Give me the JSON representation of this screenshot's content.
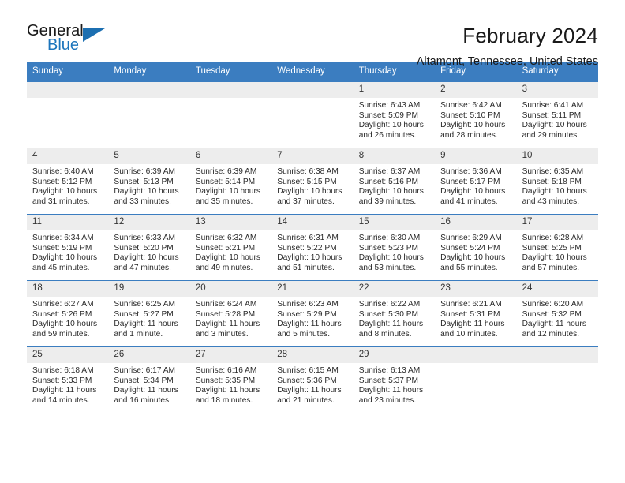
{
  "brand": {
    "name_part1": "General",
    "name_part2": "Blue",
    "accent_color": "#1c75bc"
  },
  "header": {
    "title": "February 2024",
    "subtitle": "Altamont, Tennessee, United States",
    "header_bg_color": "#3b7dc0"
  },
  "weekdays": [
    "Sunday",
    "Monday",
    "Tuesday",
    "Wednesday",
    "Thursday",
    "Friday",
    "Saturday"
  ],
  "weeks": [
    [
      {
        "day": "",
        "sunrise": "",
        "sunset": "",
        "daylight1": "",
        "daylight2": ""
      },
      {
        "day": "",
        "sunrise": "",
        "sunset": "",
        "daylight1": "",
        "daylight2": ""
      },
      {
        "day": "",
        "sunrise": "",
        "sunset": "",
        "daylight1": "",
        "daylight2": ""
      },
      {
        "day": "",
        "sunrise": "",
        "sunset": "",
        "daylight1": "",
        "daylight2": ""
      },
      {
        "day": "1",
        "sunrise": "Sunrise: 6:43 AM",
        "sunset": "Sunset: 5:09 PM",
        "daylight1": "Daylight: 10 hours",
        "daylight2": "and 26 minutes."
      },
      {
        "day": "2",
        "sunrise": "Sunrise: 6:42 AM",
        "sunset": "Sunset: 5:10 PM",
        "daylight1": "Daylight: 10 hours",
        "daylight2": "and 28 minutes."
      },
      {
        "day": "3",
        "sunrise": "Sunrise: 6:41 AM",
        "sunset": "Sunset: 5:11 PM",
        "daylight1": "Daylight: 10 hours",
        "daylight2": "and 29 minutes."
      }
    ],
    [
      {
        "day": "4",
        "sunrise": "Sunrise: 6:40 AM",
        "sunset": "Sunset: 5:12 PM",
        "daylight1": "Daylight: 10 hours",
        "daylight2": "and 31 minutes."
      },
      {
        "day": "5",
        "sunrise": "Sunrise: 6:39 AM",
        "sunset": "Sunset: 5:13 PM",
        "daylight1": "Daylight: 10 hours",
        "daylight2": "and 33 minutes."
      },
      {
        "day": "6",
        "sunrise": "Sunrise: 6:39 AM",
        "sunset": "Sunset: 5:14 PM",
        "daylight1": "Daylight: 10 hours",
        "daylight2": "and 35 minutes."
      },
      {
        "day": "7",
        "sunrise": "Sunrise: 6:38 AM",
        "sunset": "Sunset: 5:15 PM",
        "daylight1": "Daylight: 10 hours",
        "daylight2": "and 37 minutes."
      },
      {
        "day": "8",
        "sunrise": "Sunrise: 6:37 AM",
        "sunset": "Sunset: 5:16 PM",
        "daylight1": "Daylight: 10 hours",
        "daylight2": "and 39 minutes."
      },
      {
        "day": "9",
        "sunrise": "Sunrise: 6:36 AM",
        "sunset": "Sunset: 5:17 PM",
        "daylight1": "Daylight: 10 hours",
        "daylight2": "and 41 minutes."
      },
      {
        "day": "10",
        "sunrise": "Sunrise: 6:35 AM",
        "sunset": "Sunset: 5:18 PM",
        "daylight1": "Daylight: 10 hours",
        "daylight2": "and 43 minutes."
      }
    ],
    [
      {
        "day": "11",
        "sunrise": "Sunrise: 6:34 AM",
        "sunset": "Sunset: 5:19 PM",
        "daylight1": "Daylight: 10 hours",
        "daylight2": "and 45 minutes."
      },
      {
        "day": "12",
        "sunrise": "Sunrise: 6:33 AM",
        "sunset": "Sunset: 5:20 PM",
        "daylight1": "Daylight: 10 hours",
        "daylight2": "and 47 minutes."
      },
      {
        "day": "13",
        "sunrise": "Sunrise: 6:32 AM",
        "sunset": "Sunset: 5:21 PM",
        "daylight1": "Daylight: 10 hours",
        "daylight2": "and 49 minutes."
      },
      {
        "day": "14",
        "sunrise": "Sunrise: 6:31 AM",
        "sunset": "Sunset: 5:22 PM",
        "daylight1": "Daylight: 10 hours",
        "daylight2": "and 51 minutes."
      },
      {
        "day": "15",
        "sunrise": "Sunrise: 6:30 AM",
        "sunset": "Sunset: 5:23 PM",
        "daylight1": "Daylight: 10 hours",
        "daylight2": "and 53 minutes."
      },
      {
        "day": "16",
        "sunrise": "Sunrise: 6:29 AM",
        "sunset": "Sunset: 5:24 PM",
        "daylight1": "Daylight: 10 hours",
        "daylight2": "and 55 minutes."
      },
      {
        "day": "17",
        "sunrise": "Sunrise: 6:28 AM",
        "sunset": "Sunset: 5:25 PM",
        "daylight1": "Daylight: 10 hours",
        "daylight2": "and 57 minutes."
      }
    ],
    [
      {
        "day": "18",
        "sunrise": "Sunrise: 6:27 AM",
        "sunset": "Sunset: 5:26 PM",
        "daylight1": "Daylight: 10 hours",
        "daylight2": "and 59 minutes."
      },
      {
        "day": "19",
        "sunrise": "Sunrise: 6:25 AM",
        "sunset": "Sunset: 5:27 PM",
        "daylight1": "Daylight: 11 hours",
        "daylight2": "and 1 minute."
      },
      {
        "day": "20",
        "sunrise": "Sunrise: 6:24 AM",
        "sunset": "Sunset: 5:28 PM",
        "daylight1": "Daylight: 11 hours",
        "daylight2": "and 3 minutes."
      },
      {
        "day": "21",
        "sunrise": "Sunrise: 6:23 AM",
        "sunset": "Sunset: 5:29 PM",
        "daylight1": "Daylight: 11 hours",
        "daylight2": "and 5 minutes."
      },
      {
        "day": "22",
        "sunrise": "Sunrise: 6:22 AM",
        "sunset": "Sunset: 5:30 PM",
        "daylight1": "Daylight: 11 hours",
        "daylight2": "and 8 minutes."
      },
      {
        "day": "23",
        "sunrise": "Sunrise: 6:21 AM",
        "sunset": "Sunset: 5:31 PM",
        "daylight1": "Daylight: 11 hours",
        "daylight2": "and 10 minutes."
      },
      {
        "day": "24",
        "sunrise": "Sunrise: 6:20 AM",
        "sunset": "Sunset: 5:32 PM",
        "daylight1": "Daylight: 11 hours",
        "daylight2": "and 12 minutes."
      }
    ],
    [
      {
        "day": "25",
        "sunrise": "Sunrise: 6:18 AM",
        "sunset": "Sunset: 5:33 PM",
        "daylight1": "Daylight: 11 hours",
        "daylight2": "and 14 minutes."
      },
      {
        "day": "26",
        "sunrise": "Sunrise: 6:17 AM",
        "sunset": "Sunset: 5:34 PM",
        "daylight1": "Daylight: 11 hours",
        "daylight2": "and 16 minutes."
      },
      {
        "day": "27",
        "sunrise": "Sunrise: 6:16 AM",
        "sunset": "Sunset: 5:35 PM",
        "daylight1": "Daylight: 11 hours",
        "daylight2": "and 18 minutes."
      },
      {
        "day": "28",
        "sunrise": "Sunrise: 6:15 AM",
        "sunset": "Sunset: 5:36 PM",
        "daylight1": "Daylight: 11 hours",
        "daylight2": "and 21 minutes."
      },
      {
        "day": "29",
        "sunrise": "Sunrise: 6:13 AM",
        "sunset": "Sunset: 5:37 PM",
        "daylight1": "Daylight: 11 hours",
        "daylight2": "and 23 minutes."
      },
      {
        "day": "",
        "sunrise": "",
        "sunset": "",
        "daylight1": "",
        "daylight2": ""
      },
      {
        "day": "",
        "sunrise": "",
        "sunset": "",
        "daylight1": "",
        "daylight2": ""
      }
    ]
  ]
}
